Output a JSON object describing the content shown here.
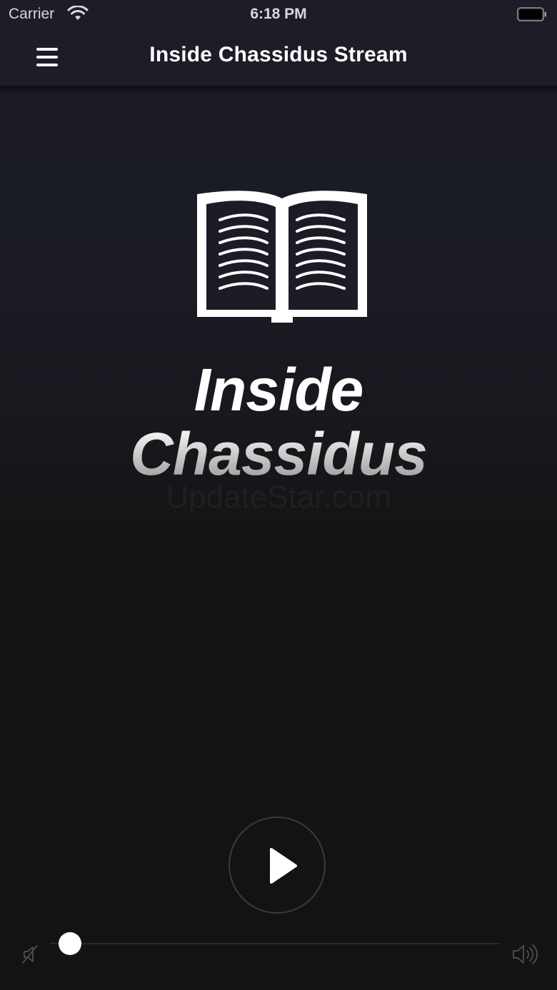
{
  "status_bar": {
    "carrier": "Carrier",
    "time": "6:18 PM"
  },
  "nav": {
    "title": "Inside Chassidus Stream",
    "menu_icon": "hamburger-menu-icon"
  },
  "artwork": {
    "icon": "open-book-icon",
    "title_line1": "Inside",
    "title_line2": "Chassidus",
    "watermark": "UpdateStar.com"
  },
  "player": {
    "play_icon": "play-icon",
    "mute_icon": "mute-speaker-icon",
    "volume_icon": "speaker-loud-icon",
    "volume_level": 0
  },
  "colors": {
    "background": "#141416",
    "nav_background": "#1c1d27",
    "accent": "#ffffff"
  }
}
